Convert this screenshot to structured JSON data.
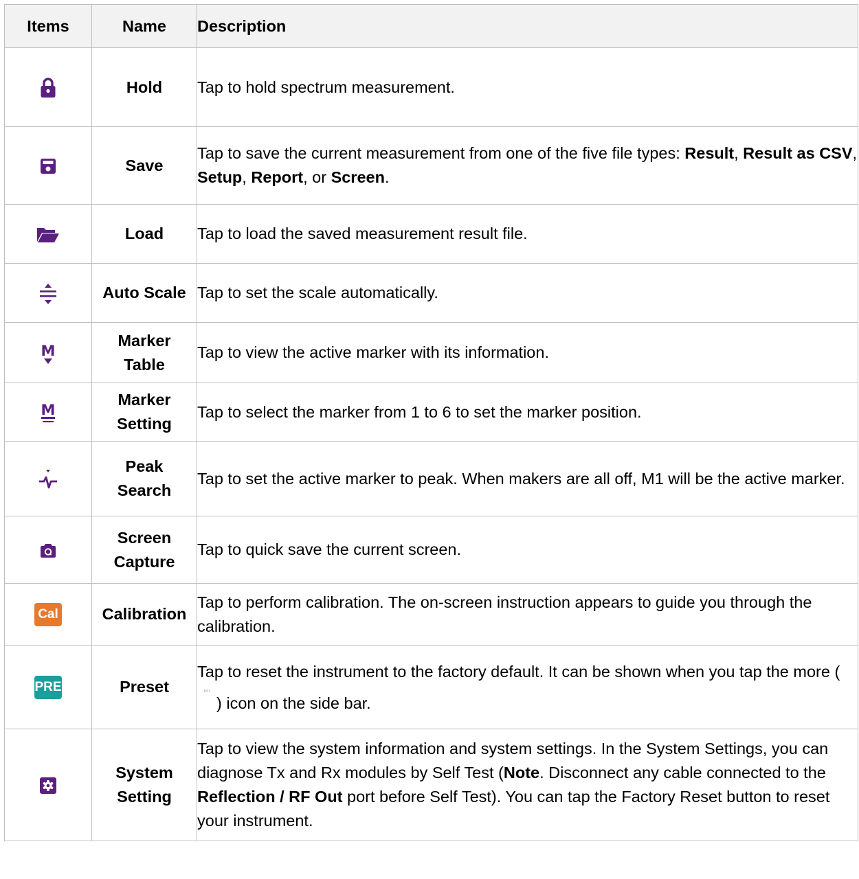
{
  "header": {
    "items": "Items",
    "name": "Name",
    "description": "Description"
  },
  "colors": {
    "icon_purple": "#5b1f7e",
    "cal_orange": "#e8792b",
    "preset_teal": "#1a9f9c"
  },
  "rows": [
    {
      "icon": "lock-icon",
      "name": "Hold",
      "desc": "Tap to hold spectrum measurement."
    },
    {
      "icon": "save-icon",
      "name": "Save",
      "desc_pre": "Tap to save the current measurement from one of the five file types: ",
      "b1": "Result",
      "s1": ", ",
      "b2": "Result as CSV",
      "s2": ", ",
      "b3": "Setup",
      "s3": ", ",
      "b4": "Report",
      "s4": ", or ",
      "b5": "Screen",
      "s5": "."
    },
    {
      "icon": "folder-open-icon",
      "name": "Load",
      "desc": "Tap to load the saved measurement result file."
    },
    {
      "icon": "auto-scale-icon",
      "name": "Auto Scale",
      "desc": "Tap to set the scale automatically."
    },
    {
      "icon": "marker-table-icon",
      "name_1": "Marker",
      "name_2": "Table",
      "desc": "Tap to view the active marker with its information."
    },
    {
      "icon": "marker-setting-icon",
      "name_1": "Marker",
      "name_2": "Setting",
      "desc": "Tap to select the marker from 1 to 6 to set the marker position."
    },
    {
      "icon": "peak-search-icon",
      "name_1": "Peak",
      "name_2": "Search",
      "desc": "Tap to set the active marker to peak. When makers are all off, M1 will be the active marker."
    },
    {
      "icon": "screen-capture-icon",
      "name_1": "Screen",
      "name_2": "Capture",
      "desc": "Tap to quick save the current screen."
    },
    {
      "icon": "calibration-icon",
      "badge": "Cal",
      "name": "Calibration",
      "desc": "Tap to perform calibration.  The on-screen instruction appears to guide you through the calibration."
    },
    {
      "icon": "preset-icon",
      "badge": "PRE",
      "name": "Preset",
      "desc_1": "Tap to reset the instrument to the factory default. It can be shown when you tap the more (",
      "desc_2": ") icon on the side bar."
    },
    {
      "icon": "gear-icon",
      "name_1": "System",
      "name_2": "Setting",
      "desc_pre": "Tap to view the system information and system settings. In the System Settings, you can diagnose Tx and Rx modules by Self Test (",
      "b1": "Note",
      "s1": ". Disconnect any cable connected to the ",
      "b2": "Reflection / RF Out",
      "s2": " port before Self Test).  You can tap the Factory Reset button to reset your instrument."
    }
  ]
}
